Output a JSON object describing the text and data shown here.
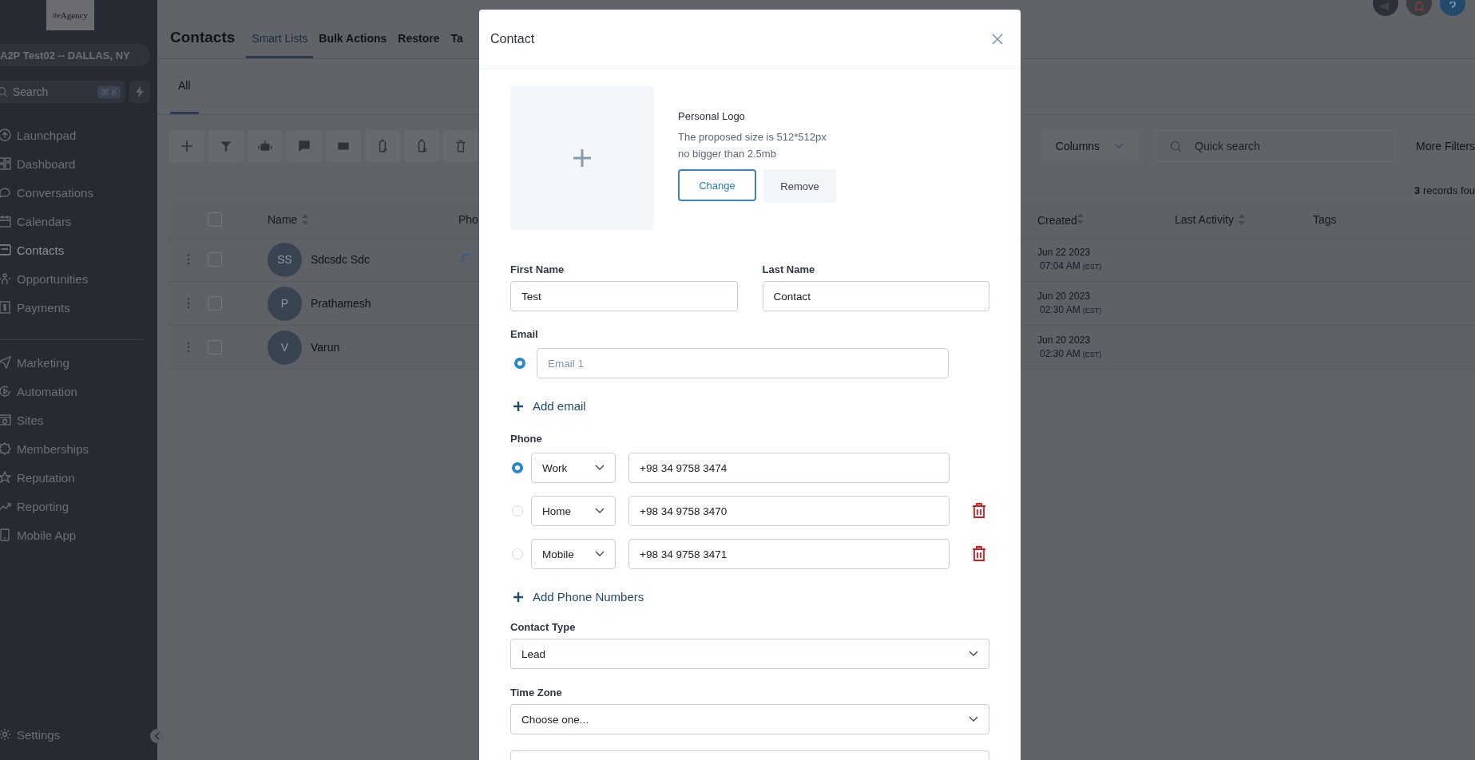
{
  "sidebar": {
    "logo": "$^{the}$Agency",
    "account": "A2P Test02 -- DALLAS, NY",
    "search": {
      "placeholder": "Search",
      "shortcut": "⌘ K"
    },
    "groups": [
      [
        {
          "label": "Launchpad",
          "selected": false
        },
        {
          "label": "Dashboard",
          "selected": false
        },
        {
          "label": "Conversations",
          "selected": false
        },
        {
          "label": "Calendars",
          "selected": false
        },
        {
          "label": "Contacts",
          "selected": true
        },
        {
          "label": "Opportunities",
          "selected": false
        },
        {
          "label": "Payments",
          "selected": false
        }
      ],
      [
        {
          "label": "Marketing",
          "selected": false
        },
        {
          "label": "Automation",
          "selected": false
        },
        {
          "label": "Sites",
          "selected": false
        },
        {
          "label": "Memberships",
          "selected": false
        },
        {
          "label": "Reputation",
          "selected": false
        },
        {
          "label": "Reporting",
          "selected": false
        },
        {
          "label": "Mobile App",
          "selected": false
        }
      ]
    ],
    "settings": "Settings"
  },
  "header": {
    "title": "Contacts",
    "tabs": [
      {
        "label": "Smart Lists",
        "selected": true
      },
      {
        "label": "Bulk Actions",
        "selected": false
      },
      {
        "label": "Restore",
        "selected": false
      },
      {
        "label": "Ta",
        "selected": false
      }
    ]
  },
  "subtabs": [
    {
      "label": "All",
      "selected": true
    }
  ],
  "toolbar": {
    "columns": "Columns",
    "search_placeholder": "Quick search",
    "more_filters": "More Filters",
    "records": "**3** records fou"
  },
  "table": {
    "select_all_checked": false,
    "columns": [
      "Name",
      "Pho",
      "Created",
      "Last Activity",
      "Tags"
    ],
    "rows": [
      {
        "initials": "SS",
        "name": "Sdcsdc Sdc",
        "checked": false,
        "phone_icon": true,
        "created_date": "Jun 22 2023",
        "created_time": "07:04 AM",
        "created_zone": "(EST)"
      },
      {
        "initials": "P",
        "name": "Prathamesh",
        "checked": false,
        "phone_icon": false,
        "created_date": "Jun 20 2023",
        "created_time": "02:30 AM",
        "created_zone": "(EST)"
      },
      {
        "initials": "V",
        "name": "Varun",
        "checked": false,
        "phone_icon": false,
        "created_date": "Jun 20 2023",
        "created_time": "02:30 AM",
        "created_zone": "(EST)"
      }
    ]
  },
  "modal": {
    "title": "Contact",
    "logo": {
      "title": "Personal Logo",
      "hint_lines": [
        "The proposed size is 512*512px",
        "no bigger than 2.5mb"
      ],
      "change": "Change",
      "remove": "Remove"
    },
    "first_name": {
      "label": "First Name",
      "value": "Test"
    },
    "last_name": {
      "label": "Last Name",
      "value": "Contact"
    },
    "email": {
      "label": "Email",
      "entries": [
        {
          "placeholder": "Email 1",
          "selected": true
        }
      ],
      "add": "Add email"
    },
    "phone": {
      "label": "Phone",
      "entries": [
        {
          "type": "Work",
          "number": "+98 34 9758 3474",
          "selected": true,
          "deletable": false
        },
        {
          "type": "Home",
          "number": "+98 34 9758 3470",
          "selected": false,
          "deletable": true
        },
        {
          "type": "Mobile",
          "number": "+98 34 9758 3471",
          "selected": false,
          "deletable": true
        }
      ],
      "add": "Add Phone Numbers"
    },
    "contact_type": {
      "label": "Contact Type",
      "value": "Lead"
    },
    "time_zone": {
      "label": "Time Zone",
      "value": "Choose one..."
    }
  }
}
